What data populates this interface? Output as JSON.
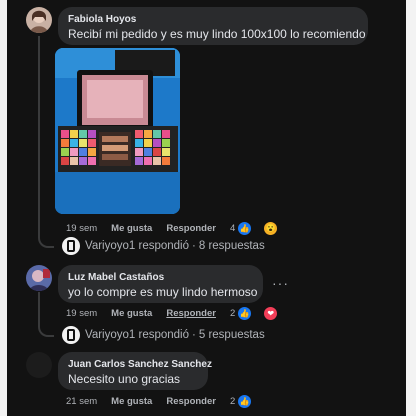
{
  "comments": [
    {
      "author": "Fabiola Hoyos",
      "text": "Recibí mi pedido y es muy lindo 100x100 lo recomiendo",
      "time": "19 sem",
      "like_label": "Me gusta",
      "reply_label": "Responder",
      "reaction_count": "4",
      "reactions": [
        "like-icon",
        "wow-icon"
      ],
      "replies": {
        "author": "Variyoyo1",
        "verb": "respondió",
        "count": "8 respuestas"
      }
    },
    {
      "author": "Luz Mabel Castaños",
      "text": "yo lo compre es muy lindo hermoso",
      "time": "19 sem",
      "like_label": "Me gusta",
      "reply_label": "Responder",
      "reaction_count": "2",
      "reactions": [
        "like-icon",
        "love-icon"
      ],
      "replies": {
        "author": "Variyoyo1",
        "verb": "respondió",
        "count": "5 respuestas"
      }
    },
    {
      "author": "Juan Carlos Sanchez Sanchez",
      "text": "Necesito uno gracias",
      "time": "21 sem",
      "like_label": "Me gusta",
      "reply_label": "Responder",
      "reaction_count": "2",
      "reactions": [
        "like-icon"
      ]
    }
  ],
  "colors": {
    "background": "#121212",
    "bubble": "#2a2b2d",
    "text_primary": "#e4e6eb",
    "text_secondary": "#b0b3b8",
    "like": "#1877f2",
    "love": "#f33e58",
    "wow": "#f7b125"
  }
}
